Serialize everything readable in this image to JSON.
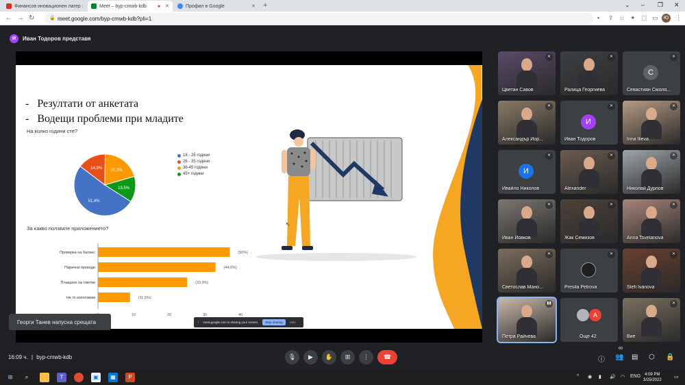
{
  "browser": {
    "tabs": [
      {
        "title": "Финансов иновационен лагер :",
        "active": false,
        "color": "#d93025"
      },
      {
        "title": "Meet – byp-cmwb-kdb",
        "active": true,
        "color": "#00832d"
      },
      {
        "title": "Профил в Google",
        "active": false,
        "color": "#4285f4"
      }
    ],
    "new_tab": "+",
    "url": "meet.google.com/byp-cmwb-kdb?pli=1",
    "profile_initial": "Ю"
  },
  "meet": {
    "presenter_initial": "И",
    "presenter_text": "Иван Тодоров представя",
    "toast": "Георги Танев напусна срещата",
    "share_banner": {
      "text": "meet.google.com is sharing your screen.",
      "stop_label": "Stop sharing",
      "hide_label": "Hide"
    },
    "meeting_time": "16:09 ч.",
    "meeting_code": "byp-cmwb-kdb",
    "people_count": "60"
  },
  "slide": {
    "bullet_1": "Резултати от анкетата",
    "bullet_2": "Водещи проблеми при младите",
    "dash": "-",
    "pie_question": "На колко години сте?",
    "bar_question": "За какво ползвате приложението?",
    "colors": {
      "blue": "#4472c4",
      "orange_red": "#e8501a",
      "orange": "#ff9900",
      "green": "#109618",
      "accent": "#f5a623",
      "navy": "#1f3864"
    }
  },
  "chart_data": [
    {
      "type": "pie",
      "title": "На колко години сте?",
      "categories": [
        "18 - 25 години",
        "26 - 35 години",
        "36-45 години",
        "45+ години"
      ],
      "values": [
        51.4,
        14.9,
        20.3,
        13.5
      ],
      "labels": [
        "51,4%",
        "14,9%",
        "20,3%",
        "13,5%"
      ],
      "colors": [
        "#4472c4",
        "#e8501a",
        "#ff9900",
        "#109618"
      ],
      "legend": "right"
    },
    {
      "type": "bar",
      "orientation": "horizontal",
      "title": "За какво ползвате приложението?",
      "categories": [
        "Проверка на баланс",
        "Парични преводи",
        "Плащане на сметки",
        "Не го използвам"
      ],
      "values": [
        37,
        33,
        25,
        9
      ],
      "labels": [
        "(50%)",
        "(44,6%)",
        "(33,3%)",
        "(11,5%)"
      ],
      "xlim": [
        0,
        40
      ],
      "xticks": [
        "0",
        "10",
        "20",
        "30",
        "40"
      ],
      "color": "#ff9900"
    }
  ],
  "participants": [
    {
      "name": "Цветан Савов",
      "type": "video",
      "initial": "",
      "color": "#5a4a6a"
    },
    {
      "name": "Ралица Георгиева",
      "type": "video",
      "initial": "",
      "color": "#3c4043"
    },
    {
      "name": "Севастиян Смоля...",
      "type": "avatar",
      "initial": "С",
      "color": "#5f6368"
    },
    {
      "name": "Александър Йор...",
      "type": "video",
      "initial": "",
      "color": "#8a7a66"
    },
    {
      "name": "Иван Тодоров",
      "type": "avatar",
      "initial": "И",
      "color": "#a142f4"
    },
    {
      "name": "Irina Ilieva",
      "type": "video",
      "initial": "",
      "color": "#b59a84"
    },
    {
      "name": "Ивайло Николов",
      "type": "avatar",
      "initial": "И",
      "color": "#1a73e8"
    },
    {
      "name": "Alexander",
      "type": "video",
      "initial": "",
      "color": "#6b5b50"
    },
    {
      "name": "Николай Дурлов",
      "type": "video",
      "initial": "",
      "color": "#9ea4a8"
    },
    {
      "name": "Иван Йовков",
      "type": "video",
      "initial": "",
      "color": "#7b7670"
    },
    {
      "name": "Жак Семизов",
      "type": "video",
      "initial": "",
      "color": "#4d4238"
    },
    {
      "name": "Anna Tsvetanova",
      "type": "video",
      "initial": "",
      "color": "#a8857a"
    },
    {
      "name": "Светослав Мано...",
      "type": "video",
      "initial": "",
      "color": "#7d6d5d"
    },
    {
      "name": "Presila Petrova",
      "type": "photo",
      "initial": "",
      "color": "#5f6368"
    },
    {
      "name": "Stefi Ivanova",
      "type": "video",
      "initial": "",
      "color": "#6a4030"
    },
    {
      "name": "Петра Райчева",
      "type": "video",
      "initial": "",
      "color": "#c9b8a8"
    },
    {
      "name": "Още 42",
      "type": "more",
      "initial": "А",
      "color": "#ea4335"
    },
    {
      "name": "Вие",
      "type": "video",
      "initial": "",
      "color": "#7a7060"
    }
  ],
  "taskbar": {
    "lang": "ENG",
    "time": "4:09 PM",
    "date": "3/25/2022"
  }
}
